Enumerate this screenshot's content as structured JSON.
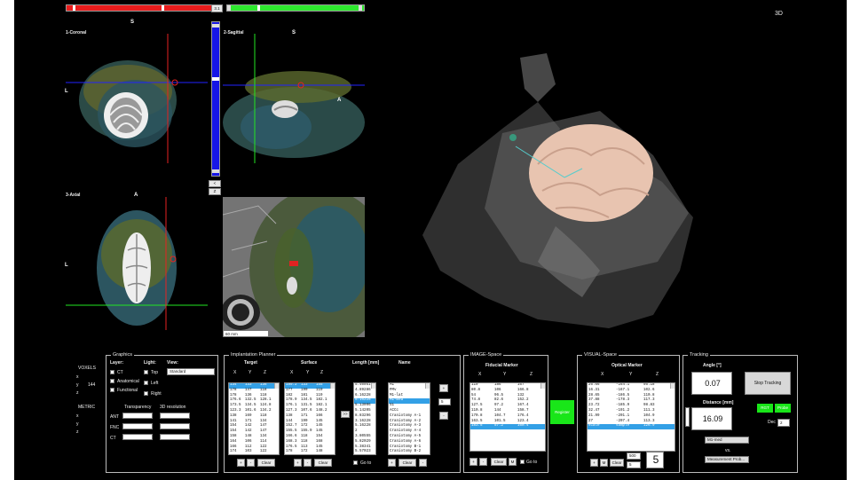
{
  "topbar": {
    "slider_value": "3.1",
    "view_3d_label": "3D"
  },
  "views": {
    "coronal": {
      "title": "1-Coronal",
      "top": "S",
      "left": "L"
    },
    "sagittal": {
      "title": "2-Sagittal",
      "top": "S",
      "right": "A"
    },
    "axial": {
      "title": "3-Axial",
      "top": "A",
      "left": "L"
    },
    "zoom": {
      "dropdown": "60 mm"
    },
    "side_buttons": [
      "<",
      "Z"
    ]
  },
  "voxels": {
    "label": "VOXELS",
    "x": "x",
    "y": "y",
    "y_value": "144",
    "z": "z"
  },
  "metric": {
    "label": "METRIC",
    "x": "x",
    "y": "y",
    "z": "z"
  },
  "graphics": {
    "title": "Graphics",
    "layer_label": "Layer:",
    "light_label": "Light:",
    "view_label": "View:",
    "layers": [
      "CT",
      "Anatomical",
      "Functional"
    ],
    "lights": [
      "Top",
      "Left",
      "Right"
    ],
    "view_value": "Standard",
    "transparency_label": "Transparency",
    "resolution_label": "3D resolution",
    "rows": [
      "ANT",
      "FNC",
      "CT"
    ]
  },
  "planner": {
    "title": "Implantation Planner",
    "target_label": "Target",
    "surface_label": "Surface",
    "length_label": "Length [mm]",
    "name_label": "Name",
    "x": "X",
    "y": "Y",
    "z": "Z",
    "target_rows": [
      [
        "134",
        "133",
        "136"
      ],
      [
        "178",
        "147",
        "118"
      ],
      [
        "178",
        "136",
        "118"
      ],
      [
        "176.6",
        "132.5",
        "128.1"
      ],
      [
        "173.5",
        "134.5",
        "124.8"
      ],
      [
        "123.3",
        "101.6",
        "134.2"
      ],
      [
        "138",
        "169",
        "118"
      ],
      [
        "141",
        "171",
        "134"
      ],
      [
        "154",
        "142",
        "147"
      ],
      [
        "154",
        "142",
        "147"
      ],
      [
        "158",
        "148",
        "134"
      ],
      [
        "164",
        "106",
        "114"
      ],
      [
        "166",
        "112",
        "122"
      ],
      [
        "174",
        "103",
        "122"
      ]
    ],
    "surface_rows": [
      [
        "199.2",
        "133",
        "155"
      ],
      [
        "177",
        "190",
        "119"
      ],
      [
        "182",
        "181",
        "119"
      ],
      [
        "178.9",
        "134.5",
        "182.1"
      ],
      [
        "176.1",
        "131.5",
        "182.1"
      ],
      [
        "127.3",
        "107.6",
        "148.2"
      ],
      [
        "138",
        "171",
        "166"
      ],
      [
        "144",
        "190",
        "145"
      ],
      [
        "152.7",
        "172",
        "145"
      ],
      [
        "155.5",
        "155.9",
        "145"
      ],
      [
        "166.6",
        "118",
        "154"
      ],
      [
        "168.3",
        "118",
        "168"
      ],
      [
        "176.5",
        "113",
        "145"
      ],
      [
        "178",
        "172",
        "148"
      ]
    ],
    "lengths": [
      "5.40051",
      "4.89286",
      "6.16228",
      "5.16228",
      "5.13096",
      "5.14205",
      "8.83296",
      "3.16228",
      "5.16228",
      "2",
      "3.80555",
      "5.82029",
      "5.38341",
      "5.57023",
      "5.98954"
    ],
    "names": [
      "M1",
      "PMv",
      "M1-lat",
      "M1-med",
      "S1",
      "ACCc",
      "Craniotomy A-1",
      "Craniotomy A-2",
      "Craniotomy A-3",
      "Craniotomy A-4",
      "Craniotomy A-5",
      "Craniotomy A-6",
      "Craniotomy B-1",
      "Craniotomy B-2",
      "Craniotomy B-3"
    ],
    "arrow_button": ">>",
    "plus": "+",
    "minus": "-",
    "count": "5",
    "clear": "Clear",
    "goto": "Go to",
    "small_btns": [
      "+",
      "-"
    ]
  },
  "image_space": {
    "title": "IMAGE-Space",
    "subtitle": "Fiducial Marker",
    "x": "X",
    "y": "Y",
    "z": "Z",
    "rows": [
      [
        "119",
        "186",
        "167"
      ],
      [
        "80.8",
        "106",
        "166.8"
      ],
      [
        "54",
        "96.5",
        "132"
      ],
      [
        "74.8",
        "82.6",
        "152.2"
      ],
      [
        "127.5",
        "97.2",
        "167.4"
      ],
      [
        "110.8",
        "144",
        "158.7"
      ],
      [
        "170.8",
        "104.7",
        "176.4"
      ],
      [
        "163.5",
        "101.5",
        "123.4"
      ],
      [
        "183.5",
        "57.2",
        "160.4"
      ]
    ],
    "clear": "Clear",
    "m": "M",
    "goto": "Go to",
    "small_btns": [
      "+",
      "-"
    ]
  },
  "register_button": "Register",
  "visual_space": {
    "title": "VISUAL-Space",
    "subtitle": "Optical Marker",
    "x": "X",
    "y": "Y",
    "z": "Z",
    "rows": [
      [
        "26.66",
        "-164.1",
        "95.18"
      ],
      [
        "16.31",
        "-167.1",
        "102.6"
      ],
      [
        "28.65",
        "-186.5",
        "110.8"
      ],
      [
        "37.88",
        "-178.3",
        "117.3"
      ],
      [
        "23.72",
        "-185.9",
        "98.83"
      ],
      [
        "32.47",
        "-191.2",
        "111.3"
      ],
      [
        "21.99",
        "-201.1",
        "104.9"
      ],
      [
        "27",
        "-207.4",
        "113.3"
      ],
      [
        "scale",
        "sample",
        "126.9"
      ]
    ],
    "clear": "Clear",
    "m": "M",
    "count_a": "500",
    "count_b": "5",
    "big_number": "5",
    "small_btns": [
      "+",
      "-"
    ]
  },
  "tracking": {
    "title": "Tracking",
    "angle_label": "Angle [°]",
    "angle_value": "0.07",
    "stop_button": "Stop Tracking",
    "distance_label": "Distance [mm]",
    "distance_value": "16.09",
    "rgt_label": "RGT",
    "probe_label": "Probe",
    "dec_label": "Dec",
    "dec_value": "2",
    "target_select": "M1-med",
    "vs_label": "vs.",
    "probe_select": "Measurement Prob..."
  },
  "colors": {
    "red_slider": "#e81c1c",
    "green_slider": "#2ee82e",
    "blue_slider": "#1616e6",
    "register_green": "#19e619"
  }
}
